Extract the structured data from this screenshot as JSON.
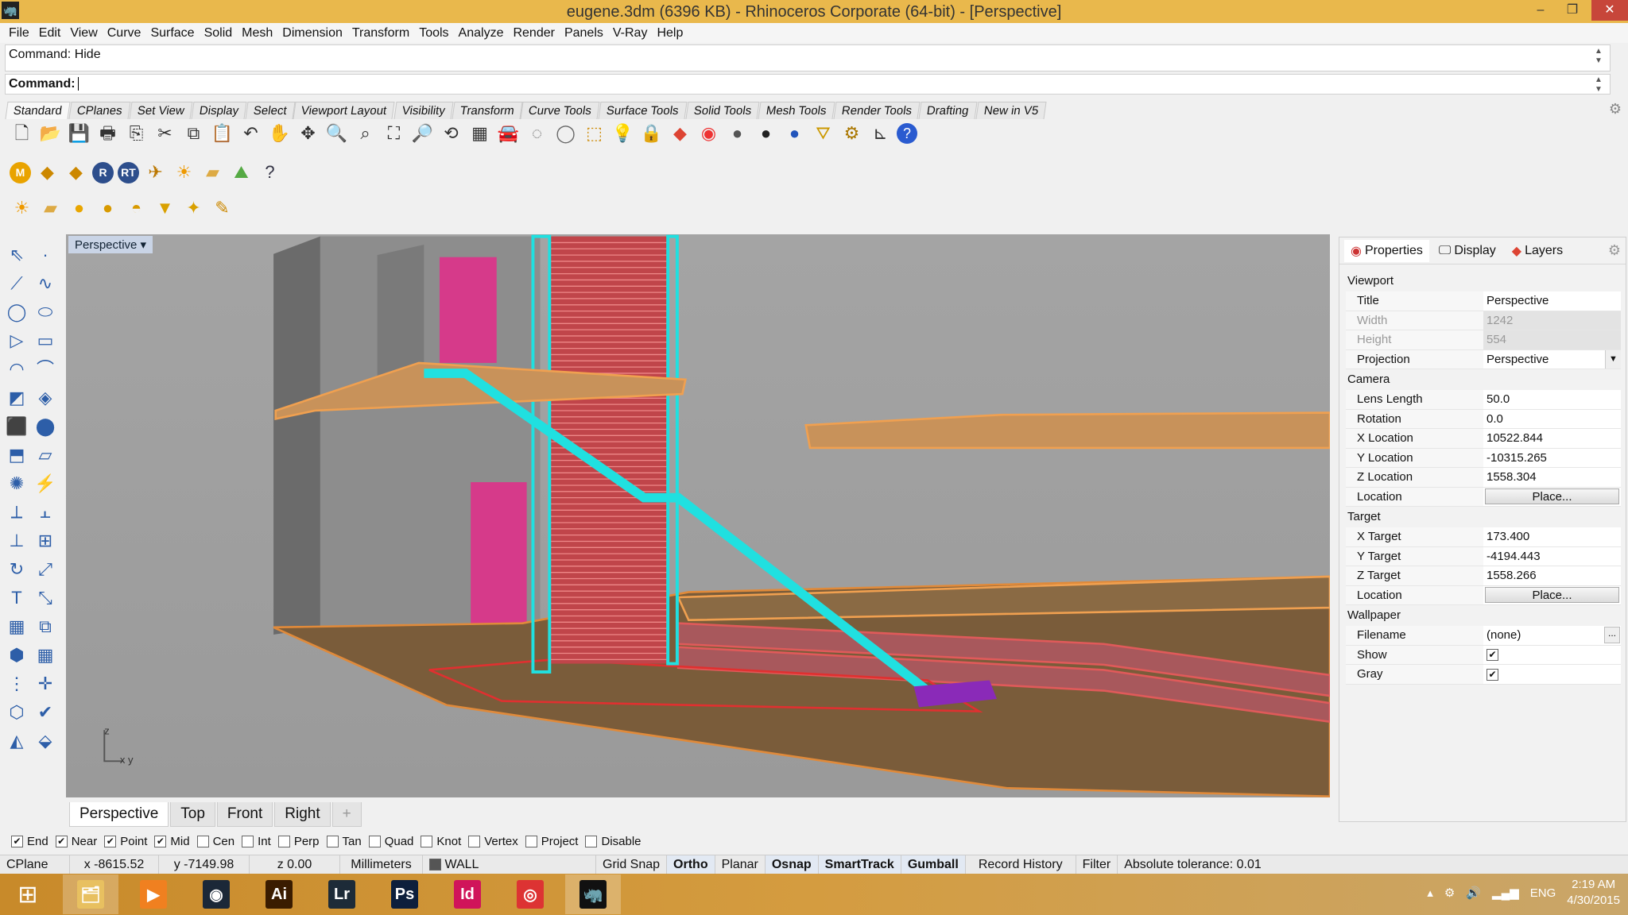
{
  "window": {
    "title": "eugene.3dm (6396 KB) - Rhinoceros Corporate (64-bit) - [Perspective]"
  },
  "menu": [
    "File",
    "Edit",
    "View",
    "Curve",
    "Surface",
    "Solid",
    "Mesh",
    "Dimension",
    "Transform",
    "Tools",
    "Analyze",
    "Render",
    "Panels",
    "V-Ray",
    "Help"
  ],
  "command": {
    "history": "Command: Hide",
    "prompt": "Command:",
    "value": ""
  },
  "toolbar_tabs": [
    "Standard",
    "CPlanes",
    "Set View",
    "Display",
    "Select",
    "Viewport Layout",
    "Visibility",
    "Transform",
    "Curve Tools",
    "Surface Tools",
    "Solid Tools",
    "Mesh Tools",
    "Render Tools",
    "Drafting",
    "New in V5"
  ],
  "toolbar_row1": [
    [
      "new-icon",
      "🗋",
      "#333"
    ],
    [
      "open-icon",
      "📂",
      "#c90"
    ],
    [
      "save-icon",
      "💾",
      "#345"
    ],
    [
      "print-icon",
      "🖶",
      "#333"
    ],
    [
      "export-icon",
      "⎘",
      "#333"
    ],
    [
      "cut-icon",
      "✂",
      "#333"
    ],
    [
      "copy-icon",
      "⧉",
      "#333"
    ],
    [
      "paste-icon",
      "📋",
      "#b80"
    ],
    [
      "undo-icon",
      "↶",
      "#333"
    ],
    [
      "pan-icon",
      "✋",
      "#333"
    ],
    [
      "move-view-icon",
      "✥",
      "#333"
    ],
    [
      "zoom-icon",
      "🔍",
      "#333"
    ],
    [
      "zoom-window-icon",
      "⌕",
      "#333"
    ],
    [
      "zoom-extents-icon",
      "⛶",
      "#333"
    ],
    [
      "zoom-selected-icon",
      "🔎",
      "#333"
    ],
    [
      "rotate-view-icon",
      "⟲",
      "#333"
    ],
    [
      "four-viewports-icon",
      "▦",
      "#333"
    ],
    [
      "car-icon",
      "🚘",
      "#c22"
    ],
    [
      "hide-icon",
      "◌",
      "#666"
    ],
    [
      "show-icon",
      "◯",
      "#666"
    ],
    [
      "select-icon",
      "⬚",
      "#c80"
    ],
    [
      "light-icon",
      "💡",
      "#777"
    ],
    [
      "lock-icon",
      "🔒",
      "#333"
    ],
    [
      "layer-icon",
      "◆",
      "#d43"
    ],
    [
      "color-icon",
      "◉",
      "#e33"
    ],
    [
      "shade-icon",
      "●",
      "#555"
    ],
    [
      "render-icon",
      "●",
      "#222"
    ],
    [
      "material-icon",
      "●",
      "#2255bb"
    ],
    [
      "filter-icon",
      "⛛",
      "#c90"
    ],
    [
      "options-icon",
      "⚙",
      "#a70"
    ],
    [
      "dimension-icon",
      "⊾",
      "#333"
    ],
    [
      "help-icon",
      "?",
      "#fff"
    ]
  ],
  "toolbar_row2": [
    [
      "vray-material-icon",
      "M",
      "#e9a300"
    ],
    [
      "tag-icon",
      "◆",
      "#c80"
    ],
    [
      "tags-icon",
      "◆",
      "#c80"
    ],
    [
      "vray-render-icon",
      "R",
      "#2d4e8c"
    ],
    [
      "vray-rt-icon",
      "RT",
      "#2d4e8c"
    ],
    [
      "vray-frame-icon",
      "✈",
      "#b70"
    ],
    [
      "sun-icon",
      "☀",
      "#e90"
    ],
    [
      "plane-light-icon",
      "▰",
      "#da4"
    ],
    [
      "dome-icon",
      "⛰",
      "#5a4"
    ],
    [
      "vray-help-icon",
      "?",
      "#334"
    ]
  ],
  "toolbar_row3": [
    [
      "sun-light-icon",
      "☀",
      "#e90"
    ],
    [
      "rect-light-icon",
      "▰",
      "#da4"
    ],
    [
      "sphere-light-icon",
      "●",
      "#e9a600"
    ],
    [
      "spot-light-icon",
      "●",
      "#d89a00"
    ],
    [
      "dome-light-icon",
      "◓",
      "#d89a00"
    ],
    [
      "ies-light-icon",
      "▼",
      "#d9a000"
    ],
    [
      "omni-icon",
      "✦",
      "#d9a000"
    ],
    [
      "mesh-light-icon",
      "✎",
      "#c80"
    ]
  ],
  "left_tools": [
    "select-arrow-icon",
    "point-icon",
    "polyline-icon",
    "curve-icon",
    "circle-icon",
    "ellipse-icon",
    "polygon-icon",
    "rectangle-icon",
    "arc-icon",
    "fillet-curve-icon",
    "surface-icon",
    "loft-icon",
    "box-icon",
    "boolean-icon",
    "extrude-icon",
    "surface-edit-icon",
    "gear-icon",
    "arrow-analyze-icon",
    "trim-icon",
    "split-icon",
    "join-icon",
    "explode-icon",
    "rotate-icon",
    "scale-icon",
    "text-icon",
    "dimension-icon",
    "array-icon",
    "mirror-icon",
    "mesh-icon",
    "grid-icon",
    "grid-array-icon",
    "gumball-icon",
    "cube-icon",
    "check-icon",
    "cone-icon",
    "paint-icon"
  ],
  "viewport": {
    "title": "Perspective",
    "axis_label_z": "z",
    "axis_label_xy": "x y",
    "tabs": [
      "Perspective",
      "Top",
      "Front",
      "Right"
    ],
    "add_tab": "+"
  },
  "panel": {
    "tabs": [
      "Properties",
      "Display",
      "Layers"
    ],
    "sections": [
      {
        "name": "Viewport",
        "rows": [
          {
            "k": "Title",
            "v": "Perspective"
          },
          {
            "k": "Width",
            "v": "1242",
            "disabled": true
          },
          {
            "k": "Height",
            "v": "554",
            "disabled": true
          },
          {
            "k": "Projection",
            "v": "Perspective",
            "dropdown": true
          }
        ]
      },
      {
        "name": "Camera",
        "rows": [
          {
            "k": "Lens Length",
            "v": "50.0"
          },
          {
            "k": "Rotation",
            "v": "0.0"
          },
          {
            "k": "X Location",
            "v": "10522.844"
          },
          {
            "k": "Y Location",
            "v": "-10315.265"
          },
          {
            "k": "Z Location",
            "v": "1558.304"
          },
          {
            "k": "Location",
            "button": "Place..."
          }
        ]
      },
      {
        "name": "Target",
        "rows": [
          {
            "k": "X Target",
            "v": "173.400"
          },
          {
            "k": "Y Target",
            "v": "-4194.443"
          },
          {
            "k": "Z Target",
            "v": "1558.266"
          },
          {
            "k": "Location",
            "button": "Place..."
          }
        ]
      },
      {
        "name": "Wallpaper",
        "rows": [
          {
            "k": "Filename",
            "v": "(none)",
            "browse": "..."
          },
          {
            "k": "Show",
            "check": true
          },
          {
            "k": "Gray",
            "check": true
          }
        ]
      }
    ]
  },
  "osnap": [
    {
      "label": "End",
      "on": true
    },
    {
      "label": "Near",
      "on": true
    },
    {
      "label": "Point",
      "on": true
    },
    {
      "label": "Mid",
      "on": true
    },
    {
      "label": "Cen",
      "on": false
    },
    {
      "label": "Int",
      "on": false
    },
    {
      "label": "Perp",
      "on": false
    },
    {
      "label": "Tan",
      "on": false
    },
    {
      "label": "Quad",
      "on": false
    },
    {
      "label": "Knot",
      "on": false
    },
    {
      "label": "Vertex",
      "on": false
    },
    {
      "label": "Project",
      "on": false
    },
    {
      "label": "Disable",
      "on": false
    }
  ],
  "status": {
    "cplane": "CPlane",
    "x": "x -8615.52",
    "y": "y -7149.98",
    "z": "z 0.00",
    "units": "Millimeters",
    "layer": "WALL",
    "grid_snap": "Grid Snap",
    "ortho": "Ortho",
    "planar": "Planar",
    "osnap": "Osnap",
    "smarttrack": "SmartTrack",
    "gumball": "Gumball",
    "record_history": "Record History",
    "filter": "Filter",
    "tolerance": "Absolute tolerance: 0.01"
  },
  "taskbar": {
    "apps": [
      [
        "file-explorer-icon",
        "🗂",
        "#e8c060"
      ],
      [
        "media-player-icon",
        "▶",
        "#f08020"
      ],
      [
        "steam-icon",
        "◉",
        "#1b2838"
      ],
      [
        "illustrator-icon",
        "Ai",
        "#3a1c00"
      ],
      [
        "lightroom-icon",
        "Lr",
        "#1d2b38"
      ],
      [
        "photoshop-icon",
        "Ps",
        "#0d1f3c"
      ],
      [
        "indesign-icon",
        "Id",
        "#d0145a"
      ],
      [
        "chrome-icon",
        "◎",
        "#d33"
      ],
      [
        "rhino-icon",
        "🦏",
        "#111"
      ]
    ],
    "lang": "ENG",
    "time": "2:19 AM",
    "date": "4/30/2015"
  }
}
